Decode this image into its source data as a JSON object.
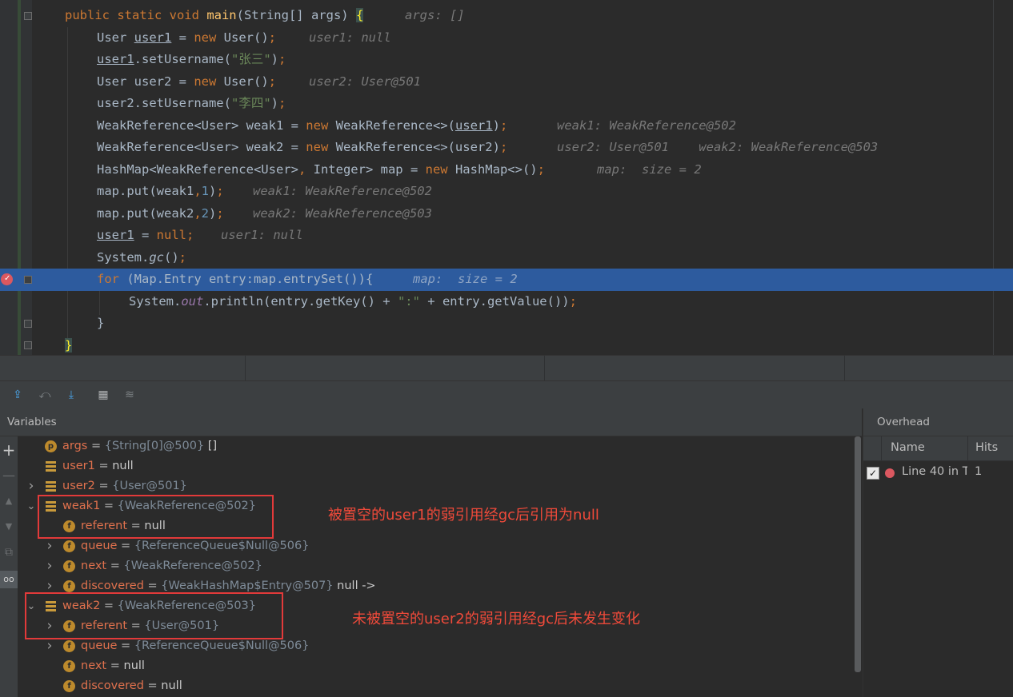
{
  "code": {
    "lines": [
      {
        "parts": [
          [
            "kw",
            "public static void "
          ],
          [
            "fn",
            "main"
          ],
          [
            "",
            "(String[] args) "
          ],
          [
            "brace-hl",
            "{"
          ]
        ],
        "inline": "args: []"
      },
      {
        "parts": [
          [
            "",
            "User "
          ],
          [
            "u",
            "user1"
          ],
          [
            "",
            " = "
          ],
          [
            "kw",
            "new "
          ],
          [
            "",
            "User()"
          ],
          [
            "kw",
            ";"
          ]
        ],
        "inline": "user1: null"
      },
      {
        "parts": [
          [
            "u",
            "user1"
          ],
          [
            "",
            ".setUsername("
          ],
          [
            "str",
            "\"张三\""
          ],
          [
            "",
            ")"
          ],
          [
            "kw",
            ";"
          ]
        ],
        "inline": ""
      },
      {
        "parts": [
          [
            "",
            "User user2 = "
          ],
          [
            "kw",
            "new "
          ],
          [
            "",
            "User()"
          ],
          [
            "kw",
            ";"
          ]
        ],
        "inline": "user2: User@501"
      },
      {
        "parts": [
          [
            "",
            "user2.setUsername("
          ],
          [
            "str",
            "\"李四\""
          ],
          [
            "",
            ")"
          ],
          [
            "kw",
            ";"
          ]
        ],
        "inline": ""
      },
      {
        "parts": [
          [
            "",
            "WeakReference<User> weak1 = "
          ],
          [
            "kw",
            "new "
          ],
          [
            "",
            "WeakReference<>("
          ],
          [
            "u",
            "user1"
          ],
          [
            "",
            ")"
          ],
          [
            "kw",
            ";"
          ]
        ],
        "inline": "weak1: WeakReference@502"
      },
      {
        "parts": [
          [
            "",
            "WeakReference<User> weak2 = "
          ],
          [
            "kw",
            "new "
          ],
          [
            "",
            "WeakReference<>(user2)"
          ],
          [
            "kw",
            ";"
          ]
        ],
        "inline": "user2: User@501    weak2: WeakReference@503"
      },
      {
        "parts": [
          [
            "",
            "HashMap<WeakReference<User>"
          ],
          [
            "kw",
            ", "
          ],
          [
            "",
            "Integer> map = "
          ],
          [
            "kw",
            "new "
          ],
          [
            "",
            "HashMap<>()"
          ],
          [
            "kw",
            ";"
          ]
        ],
        "inline": "map:  size = 2"
      },
      {
        "parts": [
          [
            "",
            "map.put(weak1"
          ],
          [
            "kw",
            ","
          ],
          [
            "num",
            "1"
          ],
          [
            "",
            ")"
          ],
          [
            "kw",
            ";"
          ]
        ],
        "inline": "weak1: WeakReference@502"
      },
      {
        "parts": [
          [
            "",
            "map.put(weak2"
          ],
          [
            "kw",
            ","
          ],
          [
            "num",
            "2"
          ],
          [
            "",
            ")"
          ],
          [
            "kw",
            ";"
          ]
        ],
        "inline": "weak2: WeakReference@503"
      },
      {
        "parts": [
          [
            "u",
            "user1"
          ],
          [
            "",
            " = "
          ],
          [
            "kw",
            "null;"
          ]
        ],
        "inline": "user1: null"
      },
      {
        "parts": [
          [
            "",
            "System."
          ],
          [
            "italic",
            "gc"
          ],
          [
            "",
            "()"
          ],
          [
            "kw",
            ";"
          ]
        ],
        "inline": ""
      },
      {
        "parts": [
          [
            "kw",
            "for "
          ],
          [
            "",
            "(Map.Entry entry:map.entrySet()){"
          ]
        ],
        "inline": "map:  size = 2"
      },
      {
        "parts": [
          [
            "",
            "System."
          ],
          [
            "static-f",
            "out"
          ],
          [
            "",
            ".println(entry.getKey() + "
          ],
          [
            "str",
            "\":\""
          ],
          [
            "",
            " + entry.getValue())"
          ],
          [
            "kw",
            ";"
          ]
        ],
        "inline": ""
      },
      {
        "parts": [
          [
            "",
            "}"
          ]
        ],
        "inline": ""
      },
      {
        "parts": [
          [
            "brace-hl",
            "}"
          ]
        ],
        "inline": ""
      }
    ]
  },
  "debugger": {
    "variables_title": "Variables",
    "rows": [
      {
        "name": "args",
        "eq": " = ",
        "type": "{String[0]@500}",
        "value": " []",
        "icon": "p"
      },
      {
        "name": "user1",
        "eq": " = ",
        "type": "",
        "value": "null",
        "icon": "local"
      },
      {
        "name": "user2",
        "eq": " = ",
        "type": "{User@501}",
        "value": "",
        "icon": "local"
      },
      {
        "name": "weak1",
        "eq": " = ",
        "type": "{WeakReference@502}",
        "value": "",
        "icon": "local"
      },
      {
        "name": "referent",
        "eq": " = ",
        "type": "",
        "value": "null",
        "icon": "f"
      },
      {
        "name": "queue",
        "eq": " = ",
        "type": "{ReferenceQueue$Null@506}",
        "value": "",
        "icon": "f"
      },
      {
        "name": "next",
        "eq": " = ",
        "type": "{WeakReference@502}",
        "value": "",
        "icon": "f"
      },
      {
        "name": "discovered",
        "eq": " = ",
        "type": "{WeakHashMap$Entry@507}",
        "value": " null ->",
        "icon": "f"
      },
      {
        "name": "weak2",
        "eq": " = ",
        "type": "{WeakReference@503}",
        "value": "",
        "icon": "local"
      },
      {
        "name": "referent",
        "eq": " = ",
        "type": "{User@501}",
        "value": "",
        "icon": "f"
      },
      {
        "name": "queue",
        "eq": " = ",
        "type": "{ReferenceQueue$Null@506}",
        "value": "",
        "icon": "f"
      },
      {
        "name": "next",
        "eq": " = ",
        "type": "",
        "value": "null",
        "icon": "f"
      },
      {
        "name": "discovered",
        "eq": " = ",
        "type": "",
        "value": "null",
        "icon": "f"
      }
    ],
    "icons": {
      "param": "p",
      "field": "f"
    }
  },
  "annotations": {
    "note1": "被置空的user1的弱引用经gc后引用为null",
    "note2": "未被置空的user2的弱引用经gc后未发生变化"
  },
  "overhead": {
    "title": "Overhead",
    "col_name": "Name",
    "col_hits": "Hits",
    "row_name": "Line 40 in T",
    "row_hits": "1",
    "row_check": "✓"
  },
  "colors": {
    "execution_line": "#2d5b9e",
    "breakpoint": "#db5860",
    "annotation": "#e23a3a"
  }
}
